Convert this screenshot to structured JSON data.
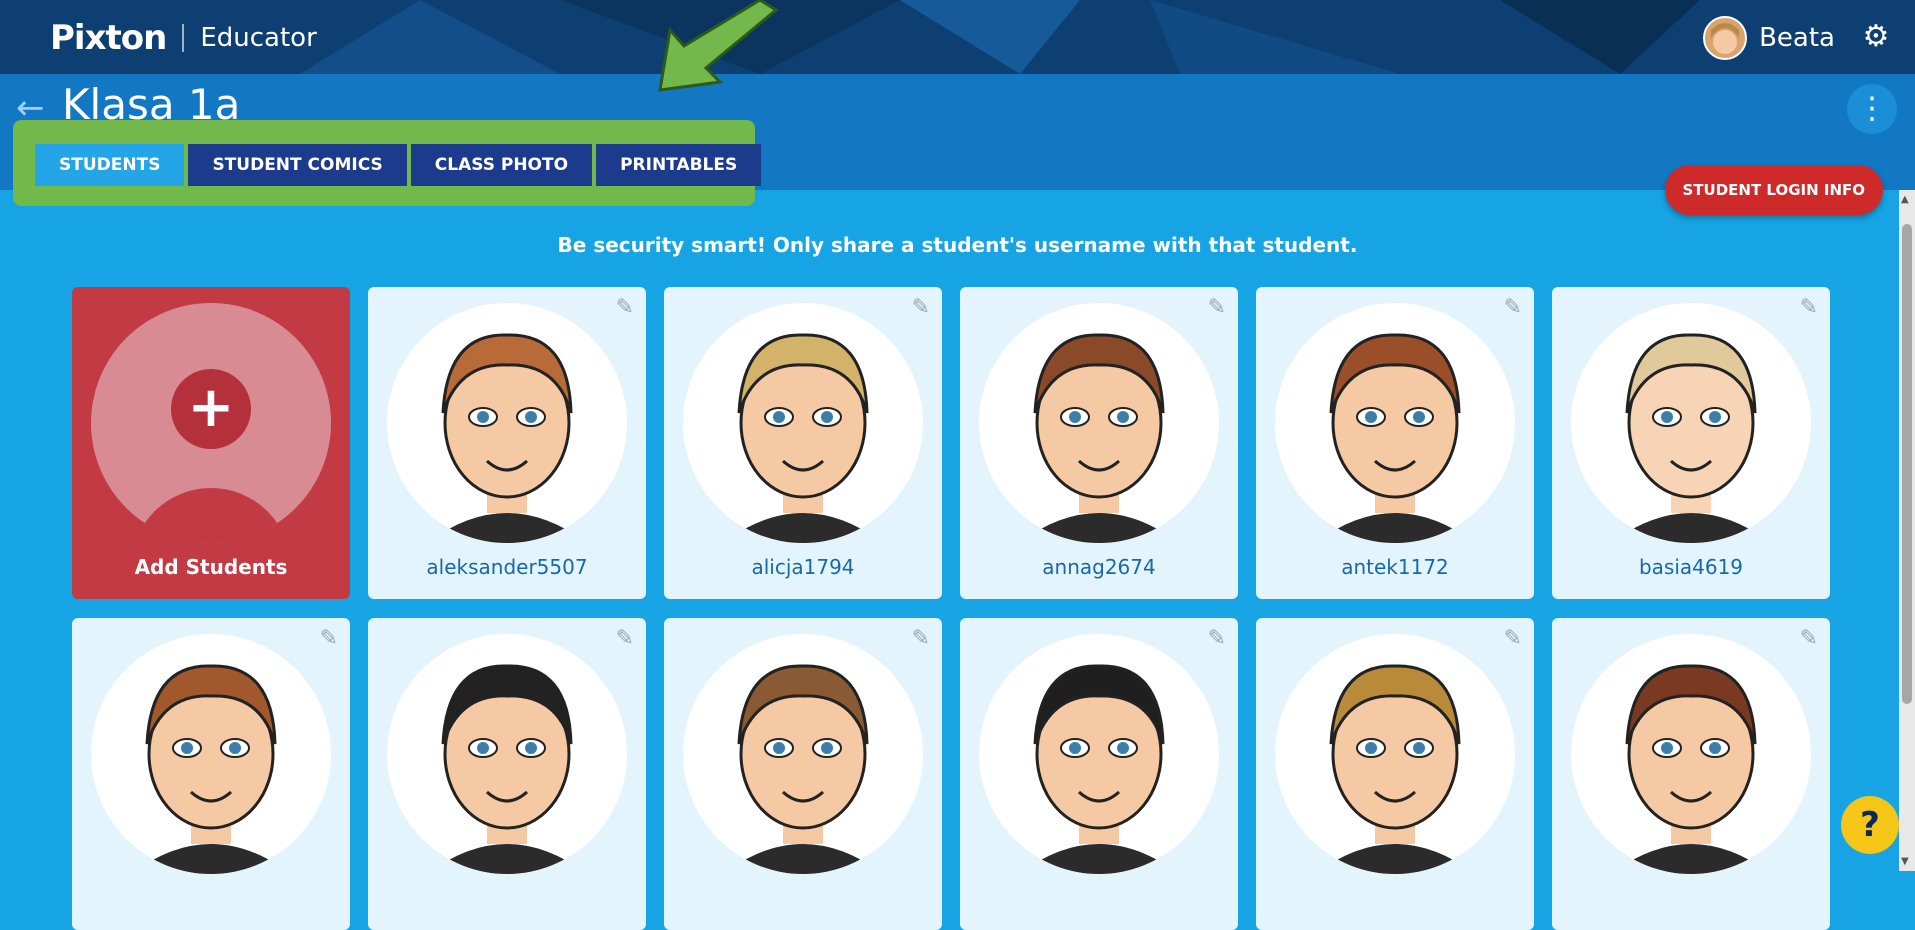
{
  "topbar": {
    "logo": "Pixton",
    "product": "Educator",
    "user_name": "Beata"
  },
  "class": {
    "title": "Klasa 1a"
  },
  "tabs": [
    {
      "label": "STUDENTS",
      "active": true
    },
    {
      "label": "STUDENT COMICS",
      "active": false
    },
    {
      "label": "CLASS PHOTO",
      "active": false
    },
    {
      "label": "PRINTABLES",
      "active": false
    }
  ],
  "login_info_label": "STUDENT LOGIN INFO",
  "notice": "Be security smart! Only share a student's username with that student.",
  "add_students_label": "Add Students",
  "students": [
    {
      "username": "aleksander5507",
      "hair": "#b86b38",
      "skin": "#f5c9a4"
    },
    {
      "username": "alicja1794",
      "hair": "#d3b36a",
      "skin": "#f5c9a4"
    },
    {
      "username": "annag2674",
      "hair": "#8a4a2a",
      "skin": "#f5c9a4"
    },
    {
      "username": "antek1172",
      "hair": "#9b4e2a",
      "skin": "#f5c9a4"
    },
    {
      "username": "basia4619",
      "hair": "#e0c99a",
      "skin": "#f7d4b6"
    },
    {
      "username": "",
      "hair": "#a0582c",
      "skin": "#f5c9a4"
    },
    {
      "username": "",
      "hair": "#222222",
      "skin": "#f5c9a4"
    },
    {
      "username": "",
      "hair": "#8a5a34",
      "skin": "#f5c9a4"
    },
    {
      "username": "",
      "hair": "#1f1f1f",
      "skin": "#f5c9a4"
    },
    {
      "username": "",
      "hair": "#b98a3a",
      "skin": "#f5c9a4"
    },
    {
      "username": "",
      "hair": "#7a3a22",
      "skin": "#f5c9a4"
    }
  ],
  "colors": {
    "topbar": "#0d3f73",
    "header": "#1378c4",
    "page": "#16a4e4",
    "tab": "#1c3b8c",
    "tab_active": "#23a5e8",
    "highlight": "#73b84a",
    "login_button": "#cf2a2a",
    "add_card": "#c23a44",
    "help": "#f5c518"
  },
  "icons": {
    "back": "arrow-left-icon",
    "settings": "gear-icon",
    "menu": "kebab-menu-icon",
    "edit": "pencil-icon",
    "add": "plus-icon",
    "help": "question-icon"
  },
  "help_label": "?"
}
